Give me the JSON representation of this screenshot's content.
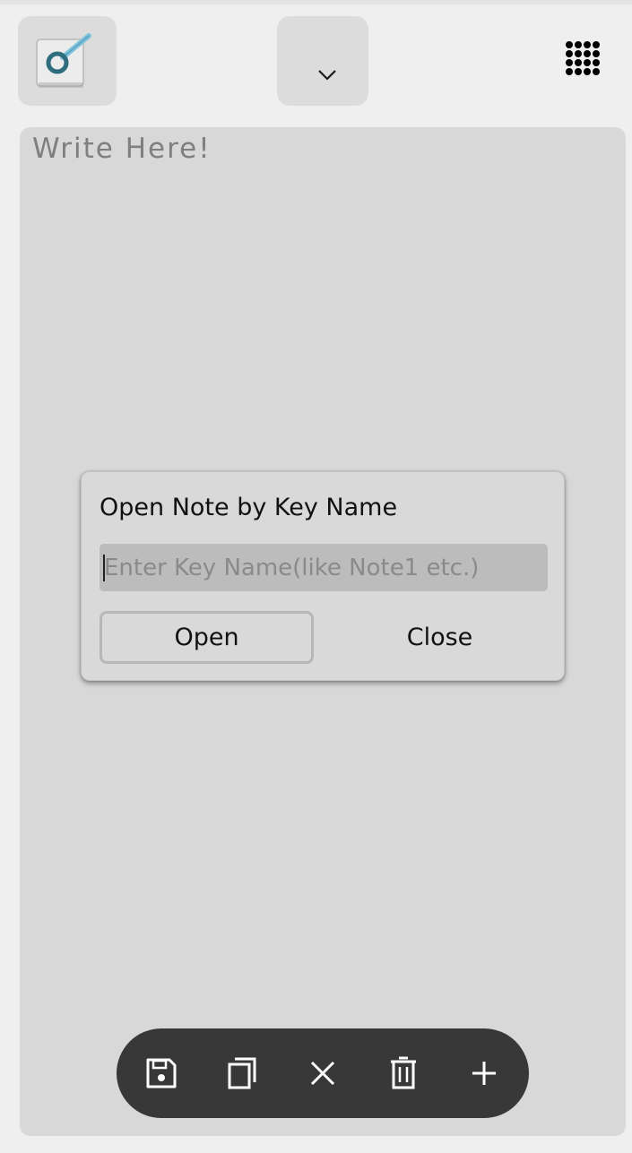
{
  "header": {
    "app_icon": "note-search-icon",
    "dropdown_icon": "chevron-down-icon",
    "menu_icon": "grid-menu-icon"
  },
  "editor": {
    "placeholder": "Write Here!"
  },
  "dialog": {
    "title": "Open Note by Key Name",
    "input_value": "",
    "input_placeholder": "Enter Key Name(like Note1 etc.)",
    "open_label": "Open",
    "close_label": "Close"
  },
  "toolbar": {
    "icons": [
      "save-icon",
      "copy-icon",
      "close-icon",
      "trash-icon",
      "plus-icon"
    ]
  },
  "colors": {
    "background": "#efefef",
    "editor_bg": "#d8d8d8",
    "toolbar_bg": "#383838",
    "accent_teal": "#2f6f7d"
  }
}
